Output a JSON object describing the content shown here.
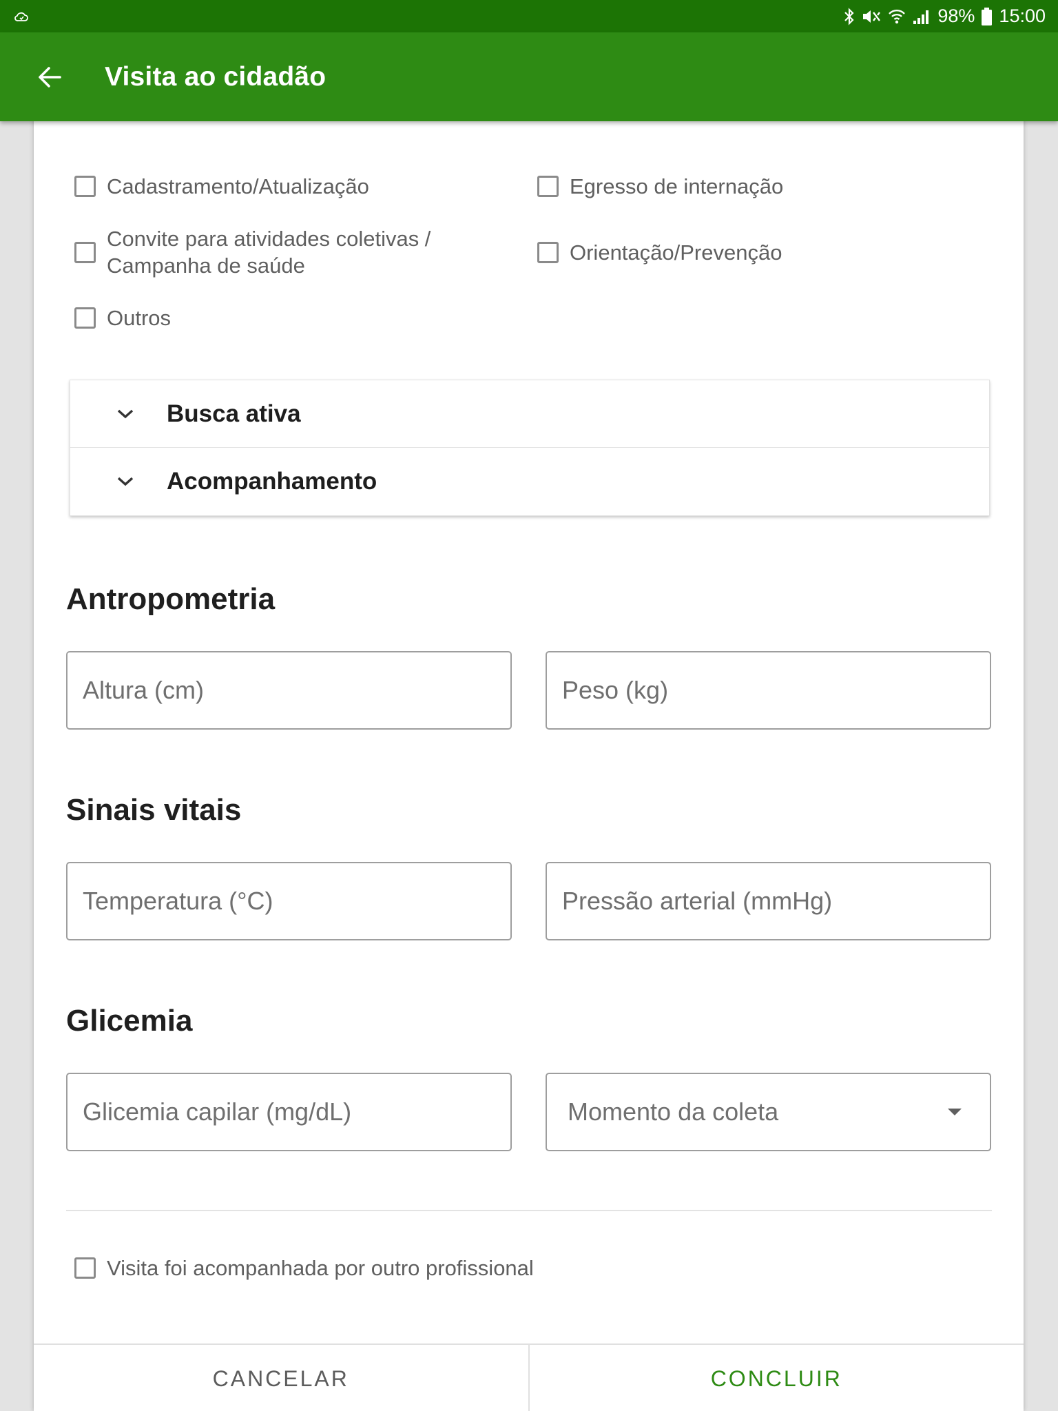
{
  "status_bar": {
    "left_icon": "cloud-sync-icon",
    "icons": [
      "bluetooth-icon",
      "mute-icon",
      "wifi-icon",
      "signal-icon",
      "battery-icon"
    ],
    "battery": "98%",
    "time": "15:00"
  },
  "app_bar": {
    "title": "Visita ao cidadão",
    "back_icon": "arrow-back-icon",
    "color": "#2e8b14"
  },
  "reasons": [
    {
      "label": "Cadastramento/Atualização",
      "checked": false
    },
    {
      "label": "Egresso de internação",
      "checked": false
    },
    {
      "label": "Convite para atividades coletivas / Campanha de saúde",
      "checked": false
    },
    {
      "label": "Orientação/Prevenção",
      "checked": false
    },
    {
      "label": "Outros",
      "checked": false
    }
  ],
  "accordion": [
    {
      "label": "Busca ativa",
      "icon": "chevron-down-icon"
    },
    {
      "label": "Acompanhamento",
      "icon": "chevron-down-icon"
    }
  ],
  "antropometria": {
    "title": "Antropometria",
    "altura_placeholder": "Altura (cm)",
    "peso_placeholder": "Peso (kg)"
  },
  "sinais_vitais": {
    "title": "Sinais vitais",
    "temperatura_placeholder": "Temperatura (°C)",
    "pressao_placeholder": "Pressão arterial (mmHg)"
  },
  "glicemia": {
    "title": "Glicemia",
    "capilar_placeholder": "Glicemia capilar (mg/dL)",
    "momento_label": "Momento da coleta"
  },
  "acompanhada": {
    "label": "Visita foi acompanhada por outro profissional",
    "checked": false
  },
  "footer": {
    "cancel": "CANCELAR",
    "confirm": "CONCLUIR"
  }
}
